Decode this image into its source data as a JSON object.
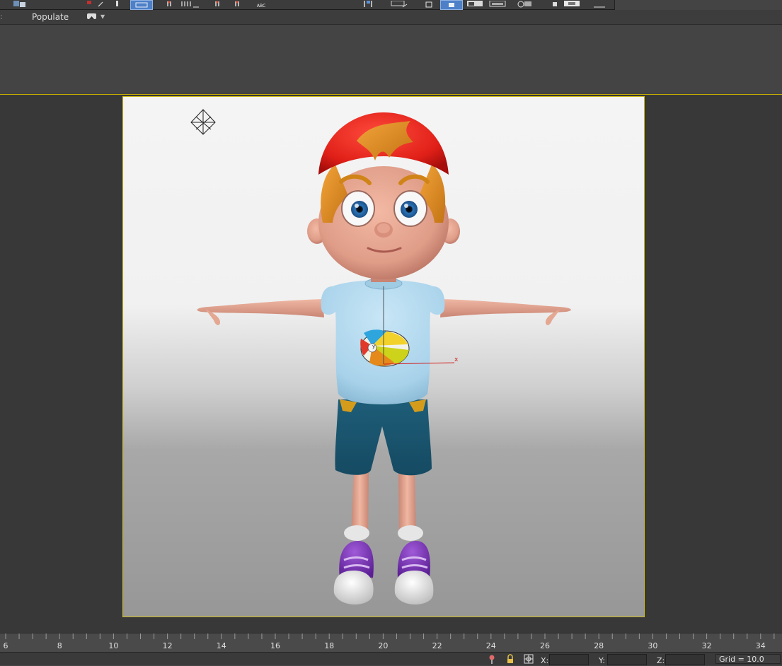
{
  "ribbon": {
    "left_stub": ":",
    "populate_tab": "Populate",
    "toggle_icon": "ribbon-minimize-icon"
  },
  "toolbar": {
    "icons": [
      "layer-manager-icon",
      "select-and-link-icon",
      "select-object-icon",
      "select-by-name-icon",
      "rectangle-selection-icon",
      "snaps-toggle-icon",
      "angle-snap-icon",
      "percent-snap-icon",
      "mirror-icon",
      "align-icon",
      "spelling-abc-icon",
      "curve-editor-icon",
      "schematic-view-icon",
      "material-editor-icon",
      "render-setup-icon",
      "rendered-frame-window-icon",
      "render-production-icon",
      "render-iterative-icon"
    ],
    "abc_label": "ABC"
  },
  "viewport": {
    "scene": "cartoon boy character in T-pose, red cap, blue shirt with beach ball, teal shorts, purple sneakers",
    "camera_icon": "light-object-icon",
    "gizmo_axis_label": "x",
    "gizmo_y_label": "y",
    "safe_frame_color": "#cdbb1e"
  },
  "timeline": {
    "ticks": [
      "6",
      "8",
      "10",
      "12",
      "14",
      "16",
      "18",
      "20",
      "22",
      "24",
      "26",
      "28",
      "30",
      "32",
      "34"
    ]
  },
  "status": {
    "x_label": "X:",
    "y_label": "Y:",
    "z_label": "Z:",
    "x_value": "",
    "y_value": "",
    "z_value": "",
    "grid": "Grid = 10.0",
    "icons": [
      "isolate-selection-icon",
      "selection-lock-icon",
      "absolute-mode-icon"
    ]
  }
}
